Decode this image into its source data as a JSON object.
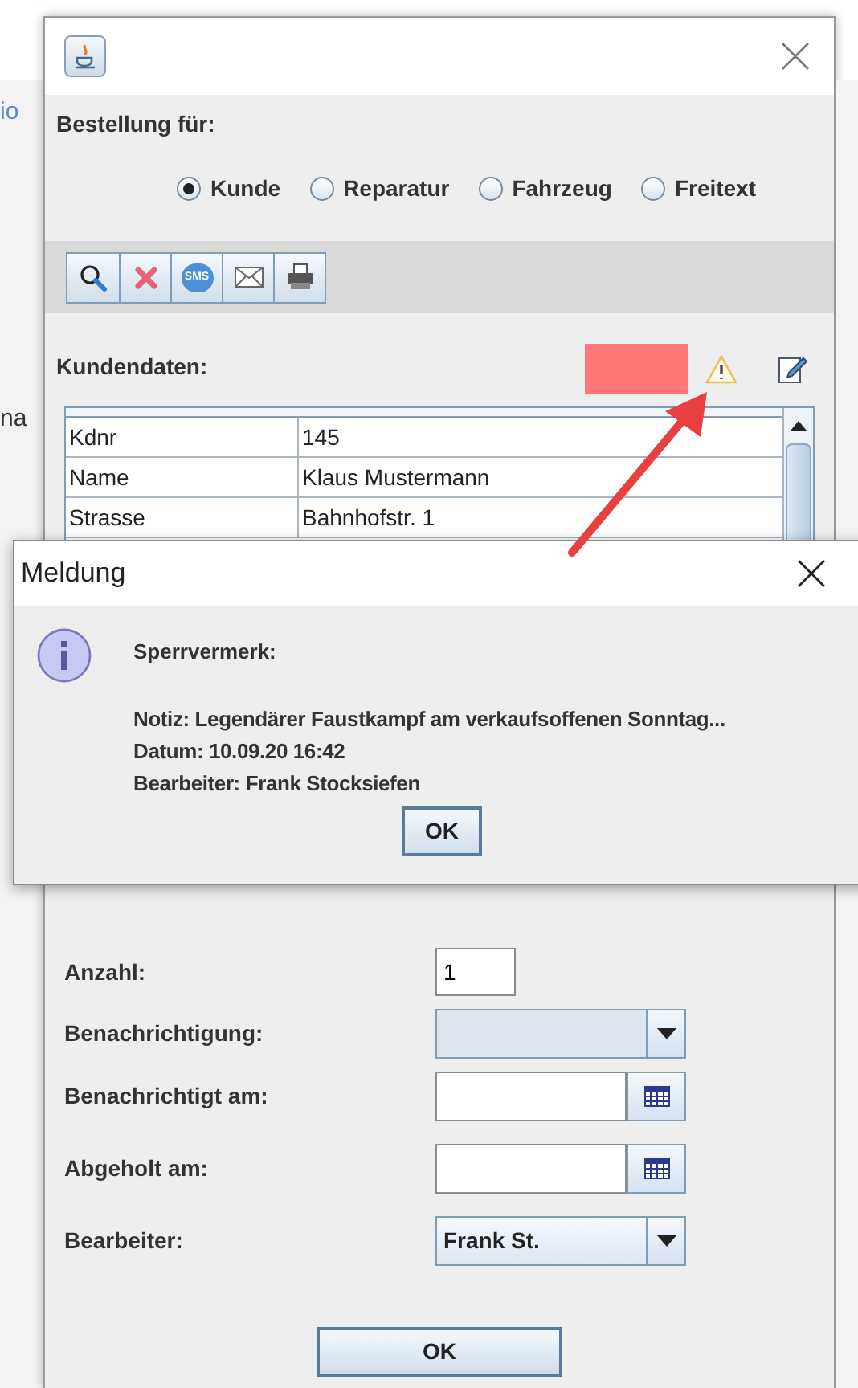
{
  "background_window": {
    "fragments": [
      "io",
      "na"
    ]
  },
  "order_for": {
    "label": "Bestellung für:",
    "options": [
      {
        "label": "Kunde",
        "selected": true
      },
      {
        "label": "Reparatur",
        "selected": false
      },
      {
        "label": "Fahrzeug",
        "selected": false
      },
      {
        "label": "Freitext",
        "selected": false
      }
    ]
  },
  "toolbar": {
    "buttons": [
      {
        "kind": "search"
      },
      {
        "kind": "delete"
      },
      {
        "kind": "sms",
        "label": "SMS"
      },
      {
        "kind": "mail"
      },
      {
        "kind": "print"
      }
    ]
  },
  "customer": {
    "label": "Kundendaten:",
    "rows": [
      {
        "field": "Kdnr",
        "value": "145"
      },
      {
        "field": "Name",
        "value": "Klaus Mustermann"
      },
      {
        "field": "Strasse",
        "value": "Bahnhofstr. 1"
      }
    ]
  },
  "message": {
    "title": "Meldung",
    "heading": "Sperrvermerk:",
    "lines": [
      "Notiz: Legendärer Faustkampf am verkaufsoffenen Sonntag...",
      "Datum: 10.09.20 16:42",
      "Bearbeiter: Frank Stocksiefen"
    ],
    "button": "OK"
  },
  "form": {
    "fields": [
      {
        "kind": "text",
        "label": "Anzahl:",
        "value": "1"
      },
      {
        "kind": "combo",
        "label": "Benachrichtigung:"
      },
      {
        "kind": "date",
        "label": "Benachrichtigt am:"
      },
      {
        "kind": "date",
        "label": "Abgeholt am:"
      },
      {
        "kind": "combo",
        "label": "Bearbeiter:",
        "value": "Frank St."
      }
    ]
  },
  "ok_button": "OK"
}
